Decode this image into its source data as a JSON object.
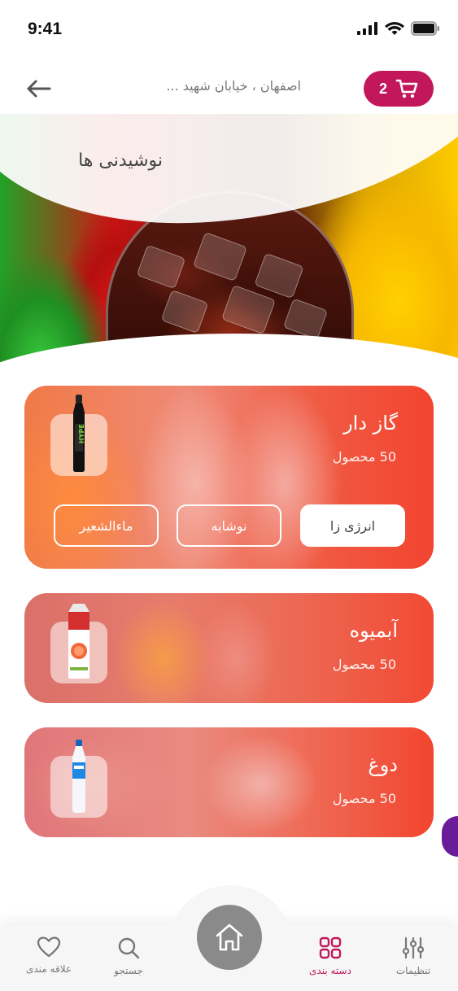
{
  "status_bar": {
    "time": "9:41"
  },
  "header": {
    "address": "اصفهان ، خیابان شهید ...",
    "cart_count": "2",
    "accent_color": "#c2185b"
  },
  "hero": {
    "title": "نوشیدنی ها"
  },
  "categories": [
    {
      "title": "گاز دار",
      "count": "50 محصول",
      "chips": [
        "انرژی زا",
        "نوشابه",
        "ماءالشعیر"
      ]
    },
    {
      "title": "آبمیوه",
      "count": "50 محصول"
    },
    {
      "title": "دوغ",
      "count": "50 محصول"
    }
  ],
  "bottom_nav": {
    "items": [
      {
        "label": "تنظیمات",
        "icon": "sliders-icon"
      },
      {
        "label": "دسته بندی",
        "icon": "grid-icon",
        "active": true
      },
      {
        "label": "home",
        "icon": "home-icon"
      },
      {
        "label": "جستجو",
        "icon": "search-icon"
      },
      {
        "label": "علاقه مندی",
        "icon": "heart-icon"
      }
    ]
  }
}
